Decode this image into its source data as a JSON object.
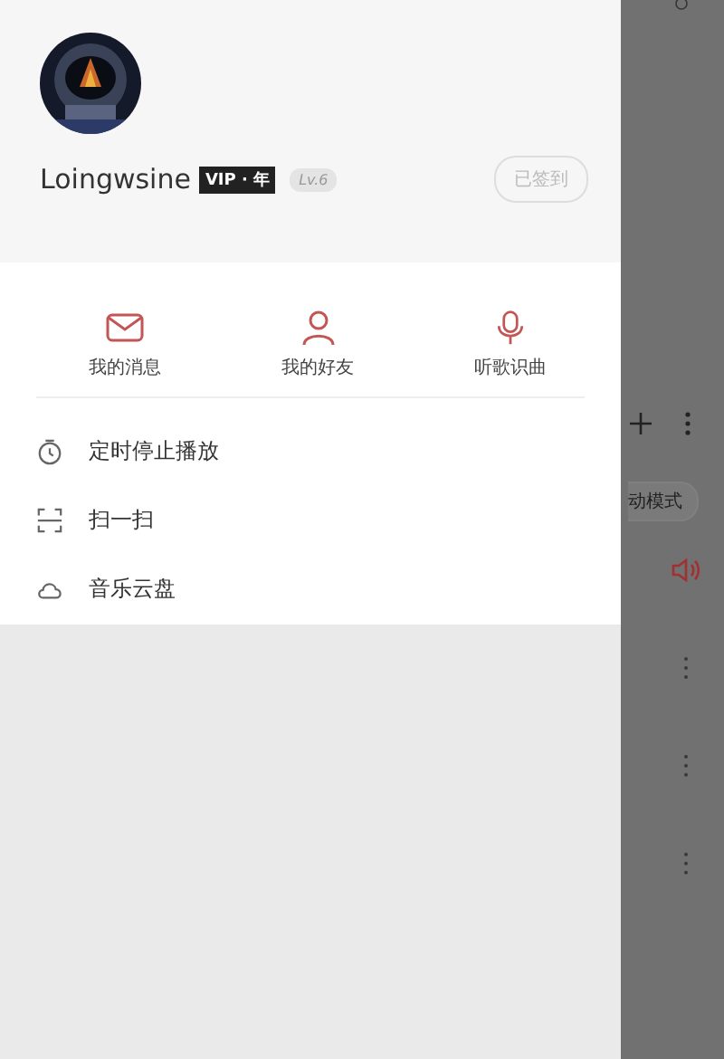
{
  "profile": {
    "name": "Loingwsine",
    "vip_badge": "VIP · 年",
    "level": "Lv.6",
    "checkin_button": "已签到"
  },
  "shortcuts": [
    {
      "kind": "mail",
      "label": "我的消息"
    },
    {
      "kind": "person",
      "label": "我的好友"
    },
    {
      "kind": "mic",
      "label": "听歌识曲"
    }
  ],
  "menu": [
    {
      "kind": "timer",
      "label": "定时停止播放"
    },
    {
      "kind": "scan",
      "label": "扫一扫"
    },
    {
      "kind": "cloud",
      "label": "音乐云盘"
    }
  ],
  "background_page": {
    "mode_chip": "动模式",
    "rows": [
      {
        "kind": "speaker"
      },
      {
        "kind": "more"
      },
      {
        "kind": "more"
      },
      {
        "kind": "more"
      }
    ]
  }
}
